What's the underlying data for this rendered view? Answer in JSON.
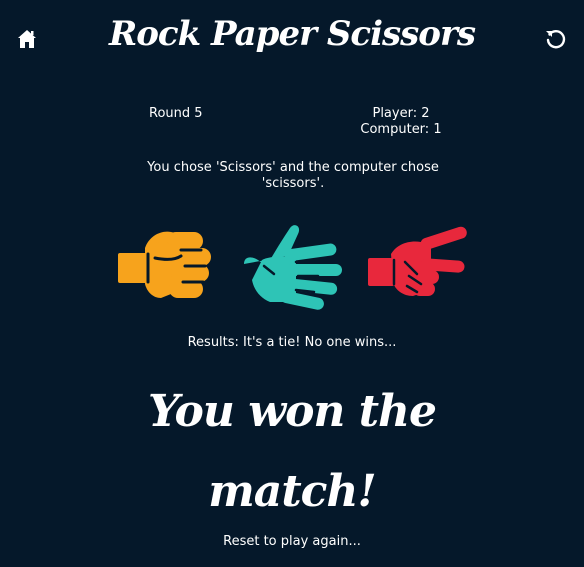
{
  "header": {
    "title": "Rock Paper Scissors",
    "home_icon": "home-icon",
    "reset_icon": "reset-icon"
  },
  "scoreboard": {
    "round": "Round 5",
    "player": "Player: 2",
    "computer": "Computer: 1"
  },
  "choice_message": "You chose 'Scissors' and the computer chose 'scissors'.",
  "hands": [
    {
      "name": "rock",
      "icon": "fist-icon",
      "color": "#f7a31c"
    },
    {
      "name": "paper",
      "icon": "open-hand-icon",
      "color": "#2ec4b6"
    },
    {
      "name": "scissors",
      "icon": "scissors-hand-icon",
      "color": "#e8283c"
    }
  ],
  "result_message": "Results: It's a tie! No one wins...",
  "match_message": "You won the match!",
  "reset_prompt": "Reset to play again...",
  "colors": {
    "background": "#05182a",
    "text": "#ffffff"
  }
}
